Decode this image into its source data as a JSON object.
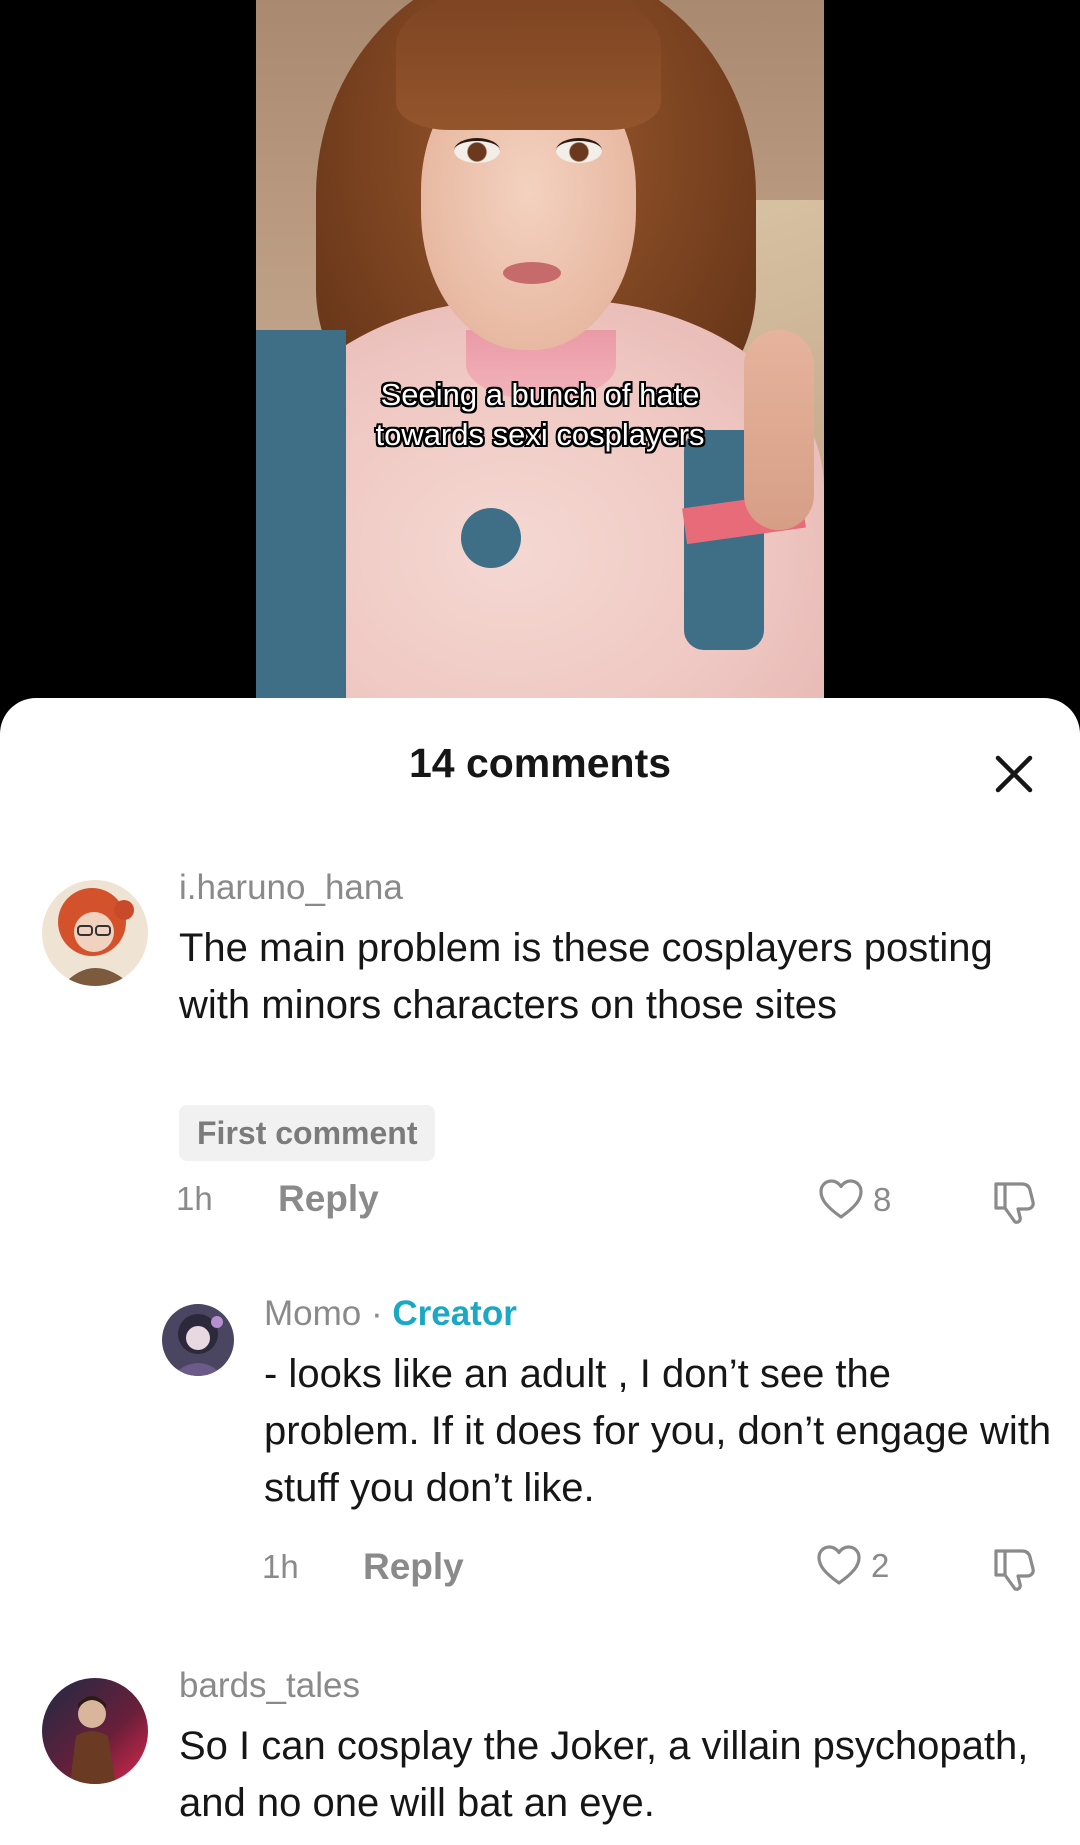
{
  "video": {
    "caption_lines": [
      "Seeing a bunch of hate",
      "towards sexi cosplayers"
    ]
  },
  "sheet": {
    "title": "14 comments",
    "close_icon": "close-icon"
  },
  "comments": [
    {
      "username": "i.haruno_hana",
      "text": "The main problem is these cosplayers posting with minors characters on those sites",
      "badge": "First comment",
      "time": "1h",
      "reply_label": "Reply",
      "likes": "8"
    },
    {
      "username": "Momo",
      "separator": " · ",
      "role": "Creator",
      "text": "- looks like an adult , I don’t see the problem. If it does for you, don’t engage with stuff you don’t like.",
      "time": "1h",
      "reply_label": "Reply",
      "likes": "2"
    },
    {
      "username": "bards_tales",
      "text": "So I can cosplay the Joker, a villain psychopath, and no one will bat an eye."
    }
  ],
  "colors": {
    "creator": "#1aa8c4",
    "muted": "#8a8a8a",
    "text": "#161616",
    "badge_bg": "#f1f1f2"
  }
}
